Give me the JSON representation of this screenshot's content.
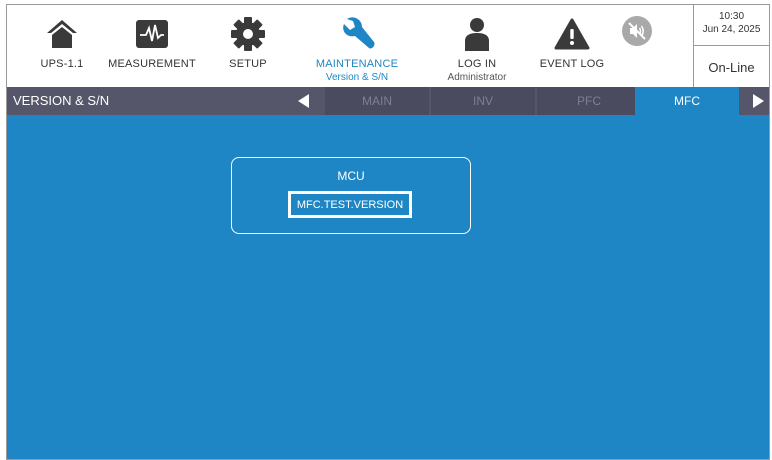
{
  "nav": {
    "ups": {
      "label": "UPS-1.1",
      "icon": "home-icon"
    },
    "measurement": {
      "label": "MEASUREMENT",
      "icon": "waveform-icon"
    },
    "setup": {
      "label": "SETUP",
      "icon": "gear-icon"
    },
    "maintenance": {
      "label": "MAINTENANCE",
      "sub": "Version & S/N",
      "icon": "wrench-icon"
    },
    "login": {
      "label": "LOG IN",
      "sub": "Administrator",
      "icon": "user-icon"
    },
    "eventlog": {
      "label": "EVENT LOG",
      "icon": "warning-icon"
    },
    "mute": {
      "icon": "speaker-muted-icon"
    }
  },
  "clock": {
    "time": "10:30",
    "date": "Jun 24, 2025"
  },
  "status": "On-Line",
  "page_title": "VERSION & S/N",
  "tabs": [
    {
      "label": "MAIN"
    },
    {
      "label": "INV"
    },
    {
      "label": "PFC"
    },
    {
      "label": "MFC"
    }
  ],
  "active_tab": "MFC",
  "panel": {
    "title": "MCU",
    "version": "MFC.TEST.VERSION"
  },
  "colors": {
    "accent": "#1f86c5",
    "tabbar": "#55566a",
    "icon_dark": "#3a3a3a"
  }
}
